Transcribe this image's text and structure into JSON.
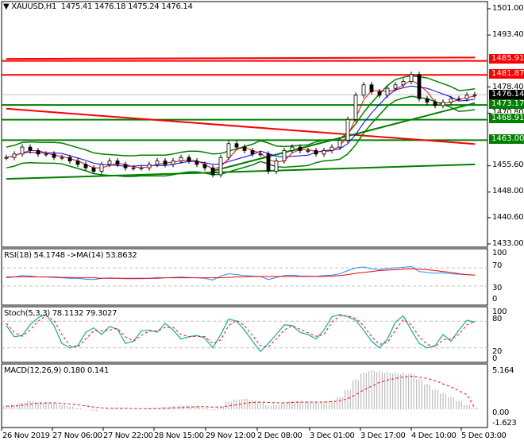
{
  "header": {
    "symbol": "XAUUSD,H1",
    "open": "1475.41",
    "high": "1476.18",
    "low": "1475.24",
    "close": "1476.14"
  },
  "chart_data": [
    {
      "type": "candlestick",
      "title": "XAUUSD,H1",
      "ylim": [
        1433,
        1501
      ],
      "yticks": [
        "1501.00",
        "1493.40",
        "1478.40",
        "1470.80",
        "1455.60",
        "1448.00",
        "1440.60",
        "1433.00"
      ],
      "xticks": [
        "26 Nov 2019",
        "27 Nov 06:00",
        "27 Nov 22:00",
        "28 Nov 15:00",
        "29 Nov 12:00",
        "2 Dec 08:00",
        "3 Dec 01:00",
        "3 Dec 17:00",
        "4 Dec 10:00",
        "5 Dec 03:00"
      ],
      "close": [
        1458,
        1459,
        1461,
        1460,
        1459,
        1459,
        1458,
        1458,
        1457,
        1456,
        1455,
        1454,
        1456,
        1457,
        1456,
        1455,
        1455,
        1455,
        1456,
        1457,
        1456,
        1457,
        1458,
        1457,
        1456,
        1455,
        1453,
        1458,
        1462,
        1461,
        1460,
        1459,
        1459,
        1454,
        1457,
        1460,
        1461,
        1460,
        1460,
        1459,
        1460,
        1461,
        1463,
        1469,
        1476,
        1479,
        1477,
        1476,
        1478,
        1479,
        1480,
        1482,
        1475,
        1474,
        1473,
        1474,
        1475,
        1475,
        1476,
        1476.14
      ],
      "levels": [
        {
          "label": "1485.91",
          "price": 1485.91,
          "color": "#ff0000"
        },
        {
          "label": "1481.87",
          "price": 1481.87,
          "color": "#ff0000"
        },
        {
          "label": "1473.17",
          "price": 1473.17,
          "color": "#008000"
        },
        {
          "label": "1468.91",
          "price": 1468.91,
          "color": "#008000"
        },
        {
          "label": "1463.00",
          "price": 1463.0,
          "color": "#008000"
        }
      ],
      "current": {
        "label": "1476.14",
        "price": 1476.14
      },
      "trendlines": [
        {
          "from": [
            0,
            1486.5
          ],
          "to": [
            59,
            1486.9
          ],
          "color": "#ff0000"
        },
        {
          "from": [
            0,
            1472.1
          ],
          "to": [
            59,
            1461.9
          ],
          "color": "#ff0000"
        },
        {
          "from": [
            0,
            1451.8
          ],
          "to": [
            59,
            1456.0
          ],
          "color": "#008000"
        },
        {
          "from": [
            26,
            1454.1
          ],
          "to": [
            59,
            1473.7
          ],
          "color": "#008000"
        }
      ]
    },
    {
      "type": "line",
      "title": "RSI(18) 54.1748  ->MA(14) 53.8632",
      "ylim": [
        0,
        100
      ],
      "yticks": [
        "100",
        "70",
        "30",
        "0"
      ],
      "levels": [
        70,
        30
      ],
      "rsi": [
        48,
        50,
        53,
        52,
        50,
        50,
        49,
        48,
        47,
        47,
        45,
        44,
        47,
        48,
        47,
        46,
        46,
        46,
        47,
        49,
        48,
        49,
        50,
        49,
        48,
        47,
        43,
        52,
        57,
        55,
        53,
        52,
        51,
        44,
        49,
        53,
        54,
        52,
        52,
        51,
        53,
        54,
        57,
        64,
        70,
        72,
        68,
        66,
        69,
        70,
        71,
        73,
        62,
        60,
        58,
        59,
        57,
        56,
        55,
        54.17
      ],
      "ma": [
        50,
        50,
        50,
        50,
        50,
        50,
        50,
        49,
        49,
        48,
        48,
        48,
        47,
        47,
        47,
        47,
        47,
        47,
        47,
        47,
        48,
        48,
        48,
        48,
        48,
        48,
        48,
        48,
        49,
        50,
        50,
        51,
        51,
        51,
        51,
        51,
        51,
        51,
        51,
        51,
        51,
        52,
        53,
        55,
        58,
        60,
        62,
        64,
        65,
        66,
        67,
        68,
        67,
        66,
        64,
        62,
        60,
        57,
        55,
        53.86
      ]
    },
    {
      "type": "line",
      "title": "Stoch(5,3,3) 78.1132 79.3027",
      "ylim": [
        0,
        100
      ],
      "yticks": [
        "100",
        "80",
        "20",
        "0"
      ],
      "levels": [
        80,
        20
      ],
      "main": [
        70,
        45,
        48,
        72,
        88,
        95,
        70,
        30,
        20,
        25,
        55,
        65,
        50,
        68,
        62,
        30,
        35,
        58,
        60,
        55,
        75,
        60,
        40,
        45,
        48,
        42,
        20,
        50,
        85,
        80,
        60,
        35,
        12,
        30,
        50,
        72,
        70,
        55,
        50,
        40,
        60,
        90,
        95,
        90,
        82,
        60,
        35,
        20,
        40,
        78,
        92,
        60,
        30,
        20,
        25,
        50,
        35,
        60,
        82,
        78.1
      ],
      "signal": [
        75,
        55,
        46,
        60,
        80,
        92,
        82,
        50,
        25,
        22,
        40,
        58,
        58,
        60,
        64,
        45,
        35,
        48,
        58,
        58,
        66,
        66,
        50,
        45,
        46,
        45,
        30,
        38,
        70,
        82,
        70,
        48,
        25,
        22,
        40,
        60,
        70,
        62,
        54,
        46,
        50,
        78,
        92,
        92,
        86,
        70,
        45,
        28,
        32,
        60,
        84,
        72,
        45,
        28,
        22,
        38,
        40,
        50,
        72,
        79.3
      ]
    },
    {
      "type": "bar",
      "title": "MACD(12,26,9) 0.180 0.141",
      "ylim": [
        -1.623,
        5.164
      ],
      "yticks": [
        "5.164",
        "0.00",
        "-1.623"
      ],
      "hist": [
        0.5,
        0.6,
        0.9,
        1.1,
        1.0,
        0.9,
        0.8,
        0.6,
        0.4,
        0.2,
        0.0,
        -0.2,
        0.0,
        0.1,
        0.2,
        0.1,
        0.0,
        0.0,
        0.1,
        0.2,
        0.3,
        0.4,
        0.5,
        0.5,
        0.4,
        0.2,
        -0.1,
        0.4,
        1.0,
        1.3,
        1.4,
        1.2,
        1.0,
        0.5,
        0.6,
        0.9,
        1.1,
        1.1,
        1.0,
        0.9,
        1.0,
        1.2,
        1.6,
        2.6,
        3.9,
        4.8,
        5.1,
        5.0,
        4.9,
        4.8,
        4.7,
        4.7,
        4.0,
        3.3,
        2.6,
        2.1,
        1.6,
        1.1,
        0.6,
        0.18
      ],
      "signal": [
        0.4,
        0.45,
        0.55,
        0.7,
        0.8,
        0.85,
        0.85,
        0.8,
        0.7,
        0.6,
        0.45,
        0.3,
        0.2,
        0.15,
        0.15,
        0.15,
        0.12,
        0.1,
        0.1,
        0.12,
        0.15,
        0.2,
        0.25,
        0.3,
        0.35,
        0.35,
        0.3,
        0.3,
        0.45,
        0.6,
        0.8,
        0.9,
        0.95,
        0.9,
        0.85,
        0.85,
        0.9,
        0.95,
        0.95,
        0.95,
        0.95,
        1.0,
        1.1,
        1.4,
        1.9,
        2.5,
        3.0,
        3.5,
        3.8,
        4.0,
        4.2,
        4.3,
        4.2,
        4.0,
        3.7,
        3.3,
        2.9,
        2.4,
        1.9,
        0.141
      ]
    }
  ]
}
